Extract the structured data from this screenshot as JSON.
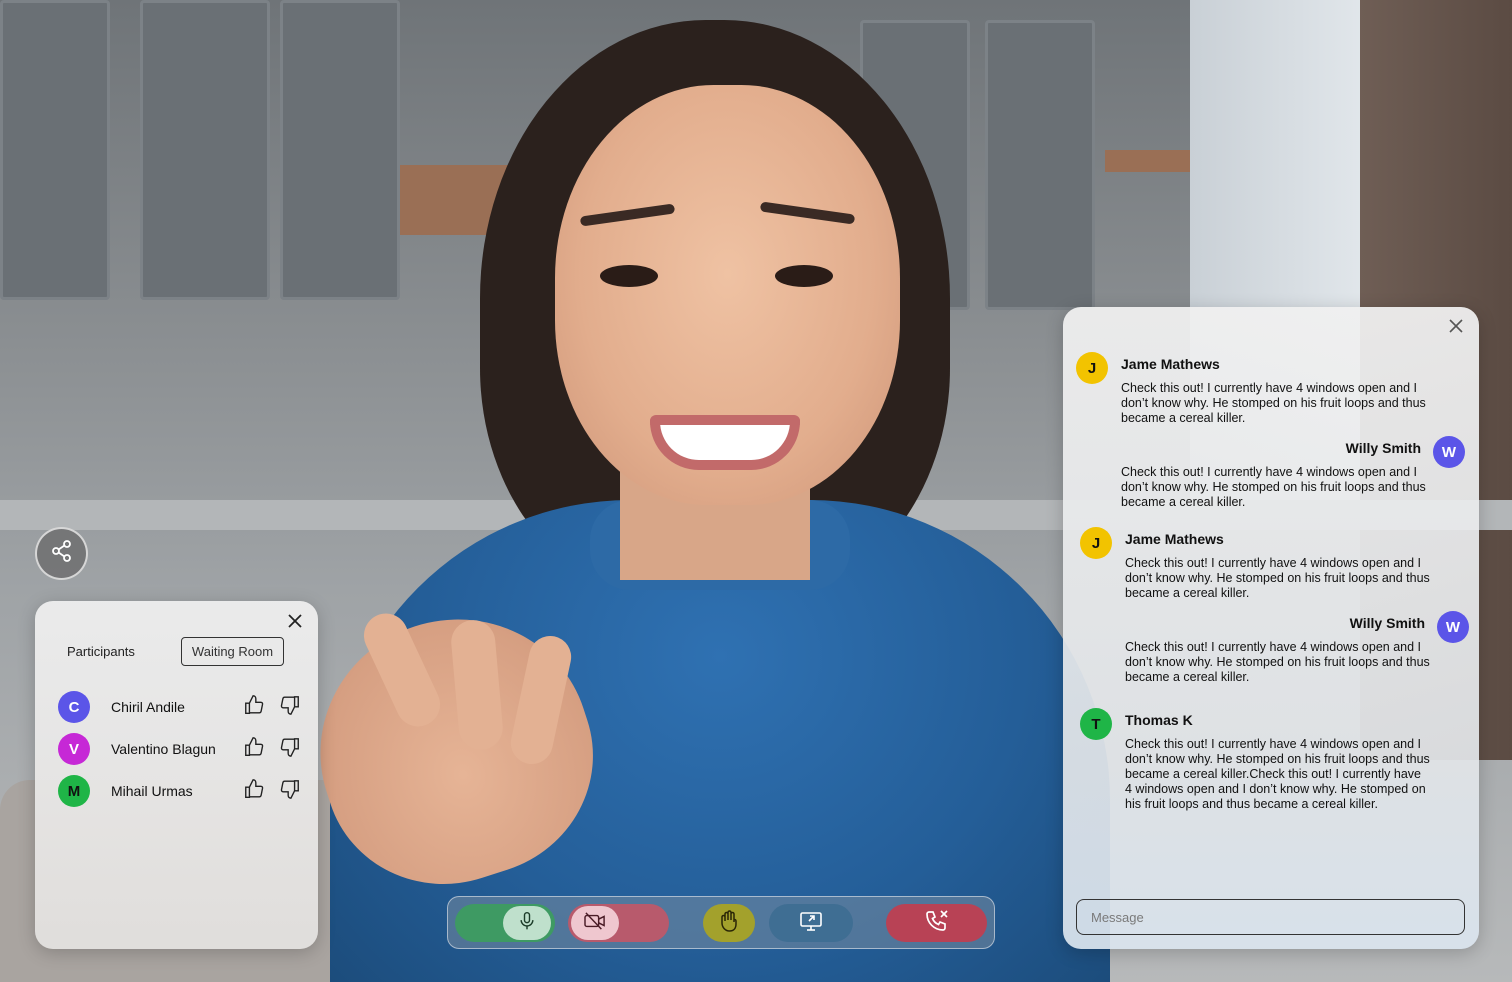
{
  "participants_panel": {
    "tabs": [
      {
        "label": "Participants"
      },
      {
        "label": "Waiting Room"
      }
    ],
    "people": [
      {
        "initial": "C",
        "name": "Chiril Andile",
        "color": "#5b55e8"
      },
      {
        "initial": "V",
        "name": "Valentino Blagun",
        "color": "#c628d6"
      },
      {
        "initial": "M",
        "name": "Mihail Urmas",
        "color": "#1fb547"
      }
    ],
    "icons": {
      "close": "close-icon",
      "approve": "thumbs-up-icon",
      "reject": "thumbs-down-icon"
    }
  },
  "share": {
    "icon": "share-icon"
  },
  "controls": {
    "mic": {
      "icon": "microphone-icon",
      "color": "#3e9a63"
    },
    "camera": {
      "icon": "camera-off-icon",
      "color": "#b85a6c"
    },
    "raise_hand": {
      "icon": "raise-hand-icon",
      "color": "#a3a12c"
    },
    "screen_share": {
      "icon": "screen-share-icon",
      "color": "#3f6e93"
    },
    "end_call": {
      "icon": "end-call-icon",
      "color": "#b84255"
    }
  },
  "chat": {
    "messages": [
      {
        "initial": "J",
        "name": "Jame Mathews",
        "color": "#f2c300",
        "text": "Check this out! I currently have 4 windows open and I don’t know why. He stomped on his fruit loops and thus became a cereal killer."
      },
      {
        "initial": "W",
        "name": "Willy Smith",
        "color": "#5b55e8",
        "text": "Check this out! I currently have 4 windows open and I don’t know why. He stomped on his fruit loops and thus became a cereal killer."
      },
      {
        "initial": "J",
        "name": "Jame Mathews",
        "color": "#f2c300",
        "text": "Check this out! I currently have 4 windows open and I don’t know why. He stomped on his fruit loops and thus became a cereal killer."
      },
      {
        "initial": "W",
        "name": "Willy Smith",
        "color": "#5b55e8",
        "text": "Check this out! I currently have 4 windows open and I don’t know why. He stomped on his fruit loops and thus became a cereal killer."
      },
      {
        "initial": "T",
        "name": "Thomas K",
        "color": "#1fb547",
        "text": "Check this out! I currently have 4 windows open and I don’t know why. He stomped on his fruit loops and thus became a cereal killer.Check this out! I currently have 4 windows open  and I don’t know why. He stomped on his fruit loops and thus became a cereal killer."
      }
    ],
    "input_placeholder": "Message"
  }
}
